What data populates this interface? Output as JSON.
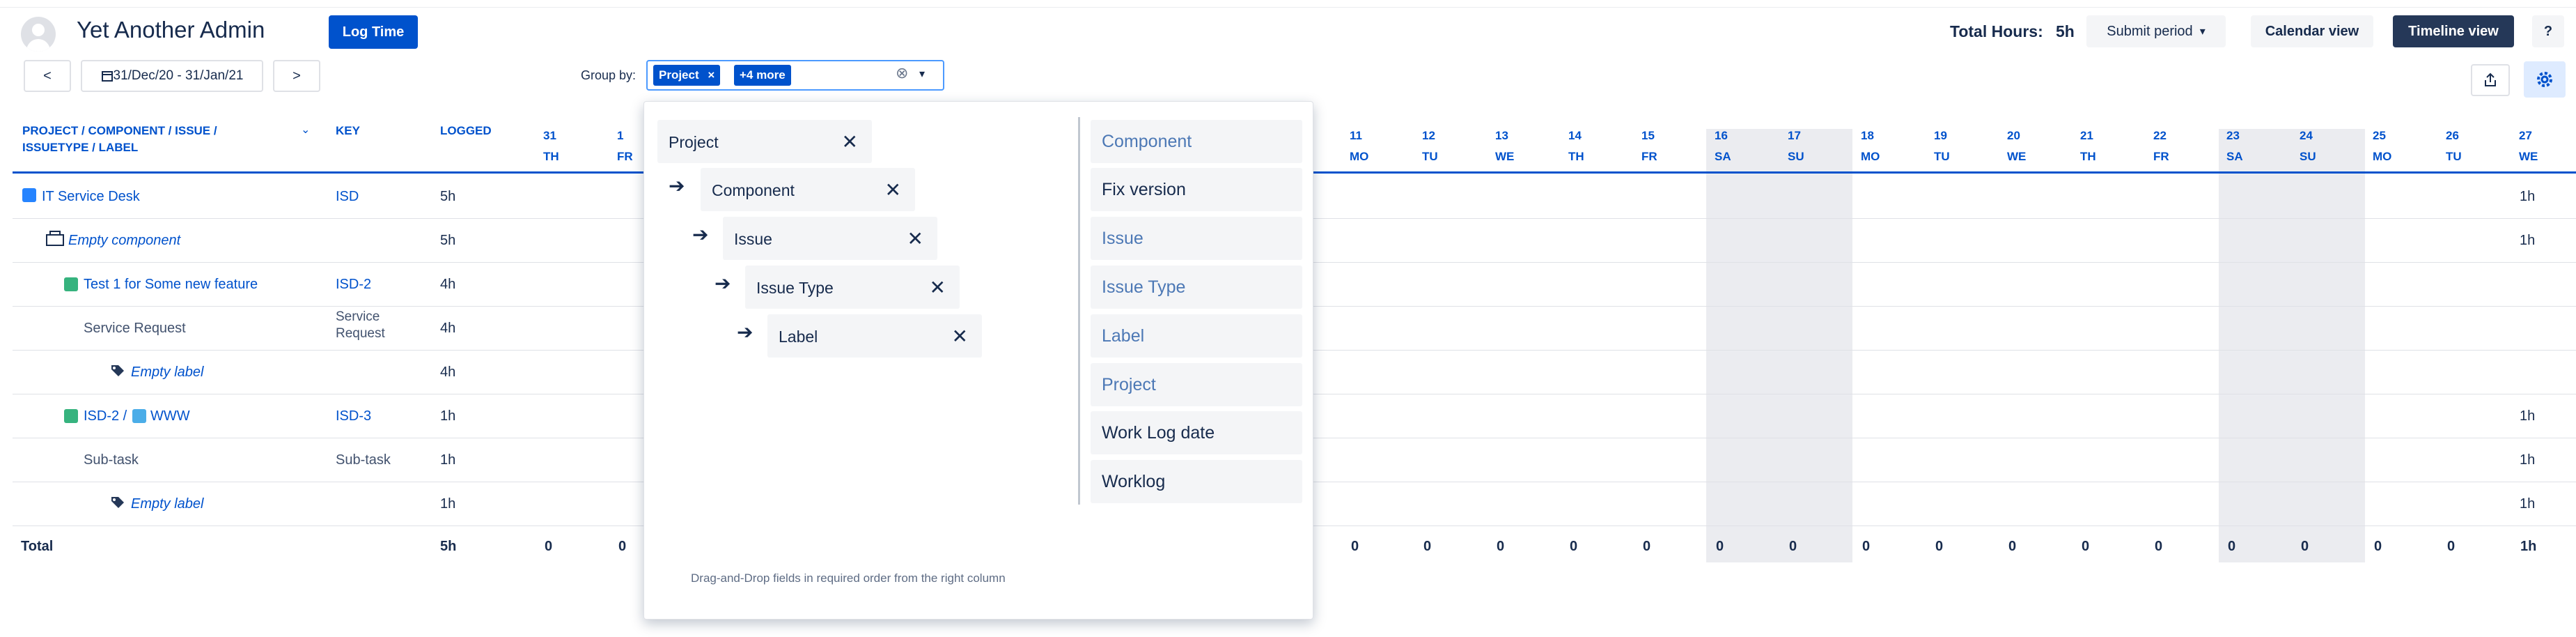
{
  "header": {
    "title": "Yet Another Admin",
    "log_time": "Log Time",
    "total_hours_label": "Total Hours:",
    "total_hours_value": "5h",
    "submit_period": "Submit period",
    "calendar_view": "Calendar view",
    "timeline_view": "Timeline view",
    "help": "?"
  },
  "nav": {
    "prev": "<",
    "next": ">",
    "date_range": "31/Dec/20 - 31/Jan/21",
    "group_by_label": "Group by:",
    "group_tag_project": "Project",
    "group_tag_more": "+4 more",
    "clear_icon": "⊗"
  },
  "table": {
    "col_project": "PROJECT / COMPONENT / ISSUE / ISSUETYPE / LABEL",
    "col_key": "KEY",
    "col_logged": "LOGGED",
    "days": [
      {
        "d": "31",
        "w": "TH"
      },
      {
        "d": "1",
        "w": "FR"
      },
      {
        "d": "11",
        "w": "MO"
      },
      {
        "d": "12",
        "w": "TU"
      },
      {
        "d": "13",
        "w": "WE"
      },
      {
        "d": "14",
        "w": "TH"
      },
      {
        "d": "15",
        "w": "FR"
      },
      {
        "d": "16",
        "w": "SA"
      },
      {
        "d": "17",
        "w": "SU"
      },
      {
        "d": "18",
        "w": "MO"
      },
      {
        "d": "19",
        "w": "TU"
      },
      {
        "d": "20",
        "w": "WE"
      },
      {
        "d": "21",
        "w": "TH"
      },
      {
        "d": "22",
        "w": "FR"
      },
      {
        "d": "23",
        "w": "SA"
      },
      {
        "d": "24",
        "w": "SU"
      },
      {
        "d": "25",
        "w": "MO"
      },
      {
        "d": "26",
        "w": "TU"
      },
      {
        "d": "27",
        "w": "WE"
      }
    ],
    "rows": [
      {
        "name": "IT Service Desk",
        "key": "ISD",
        "logged": "5h",
        "last": "1h"
      },
      {
        "name": "Empty component",
        "key": "",
        "logged": "5h",
        "last": "1h"
      },
      {
        "name": "Test 1 for Some new feature",
        "key": "ISD-2",
        "logged": "4h",
        "last": ""
      },
      {
        "name": "Service Request",
        "key": "Service Request",
        "logged": "4h",
        "last": ""
      },
      {
        "name": "Empty label",
        "key": "",
        "logged": "4h",
        "last": ""
      },
      {
        "name": "WWW",
        "name_prefix": "ISD-2 /",
        "key": "ISD-3",
        "logged": "1h",
        "last": "1h"
      },
      {
        "name": "Sub-task",
        "key": "Sub-task",
        "logged": "1h",
        "last": "1h"
      },
      {
        "name": "Empty label",
        "key": "",
        "logged": "1h",
        "last": "1h"
      }
    ],
    "total_label": "Total",
    "total_logged": "5h",
    "total_zero": "0",
    "total_last": "1h"
  },
  "popup": {
    "selected": [
      "Project",
      "Component",
      "Issue",
      "Issue Type",
      "Label"
    ],
    "available": [
      "Component",
      "Fix version",
      "Issue",
      "Issue Type",
      "Label",
      "Project",
      "Work Log date",
      "Worklog"
    ],
    "hint": "Drag-and-Drop fields in required order from the right column"
  }
}
